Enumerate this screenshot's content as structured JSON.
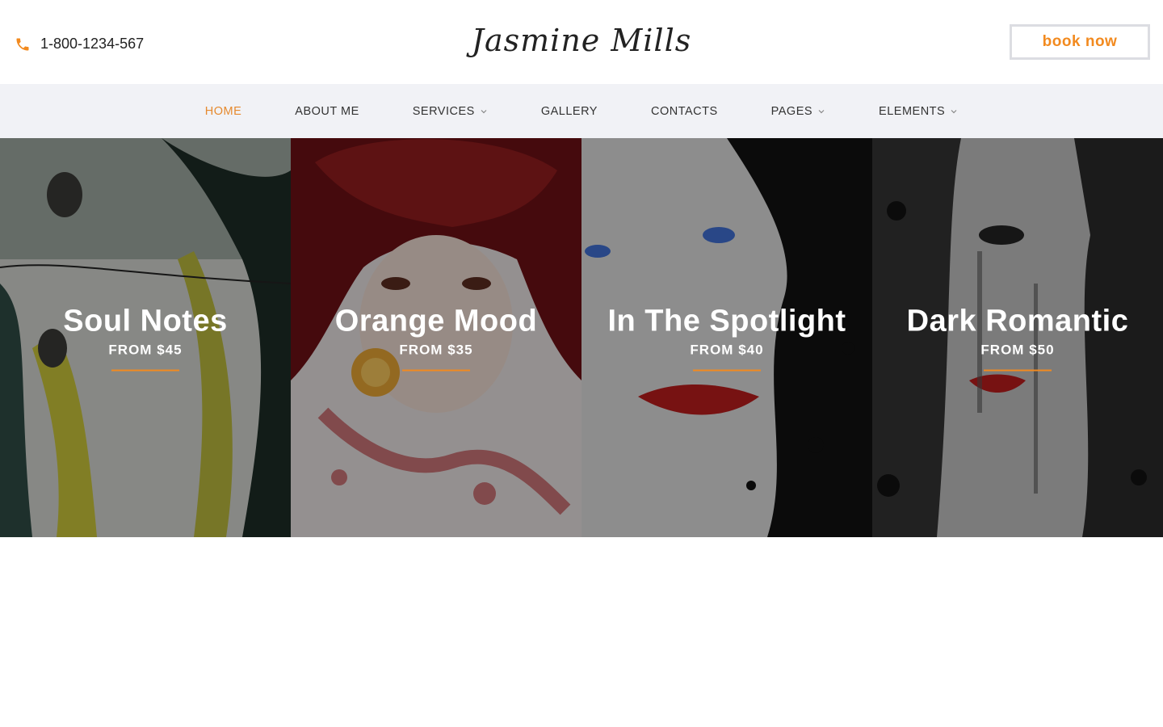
{
  "header": {
    "phone": "1-800-1234-567",
    "phone_icon": "phone-icon",
    "logo": "Jasmine Mills",
    "book_button": "book now"
  },
  "colors": {
    "accent": "#f28a1f",
    "nav_background": "#f1f2f6"
  },
  "nav": {
    "items": [
      {
        "label": "HOME",
        "active": true,
        "dropdown": false
      },
      {
        "label": "ABOUT ME",
        "active": false,
        "dropdown": false
      },
      {
        "label": "SERVICES",
        "active": false,
        "dropdown": true
      },
      {
        "label": "GALLERY",
        "active": false,
        "dropdown": false
      },
      {
        "label": "CONTACTS",
        "active": false,
        "dropdown": false
      },
      {
        "label": "PAGES",
        "active": false,
        "dropdown": true
      },
      {
        "label": "ELEMENTS",
        "active": false,
        "dropdown": true
      }
    ]
  },
  "services": [
    {
      "title": "Soul Notes",
      "price": "FROM $45"
    },
    {
      "title": "Orange Mood",
      "price": "FROM $35"
    },
    {
      "title": "In The Spotlight",
      "price": "FROM $40"
    },
    {
      "title": "Dark Romantic",
      "price": "FROM $50"
    }
  ]
}
